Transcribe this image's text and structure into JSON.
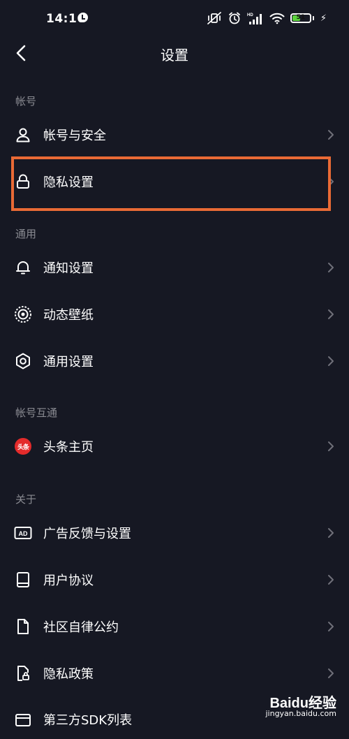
{
  "status_bar": {
    "time": "14:16",
    "network_label": "HD",
    "battery_level": "51",
    "battery_percent": 51
  },
  "nav": {
    "title": "设置"
  },
  "sections": {
    "account": "帐号",
    "general": "通用",
    "interop": "帐号互通",
    "about": "关于"
  },
  "items": {
    "account_security": "帐号与安全",
    "privacy_settings": "隐私设置",
    "notification_settings": "通知设置",
    "live_wallpaper": "动态壁纸",
    "general_settings": "通用设置",
    "toutiao_home": "头条主页",
    "ad_feedback": "广告反馈与设置",
    "user_agreement": "用户协议",
    "community_rules": "社区自律公约",
    "privacy_policy": "隐私政策",
    "third_party_sdk": "第三方SDK列表"
  },
  "icons": {
    "toutiao_badge_text": "头条",
    "ad_badge_text": "AD"
  },
  "highlight_color": "#e96a35",
  "background_color": "#161823",
  "watermark": {
    "logo": "Baidu经验",
    "url": "jingyan.baidu.com"
  }
}
